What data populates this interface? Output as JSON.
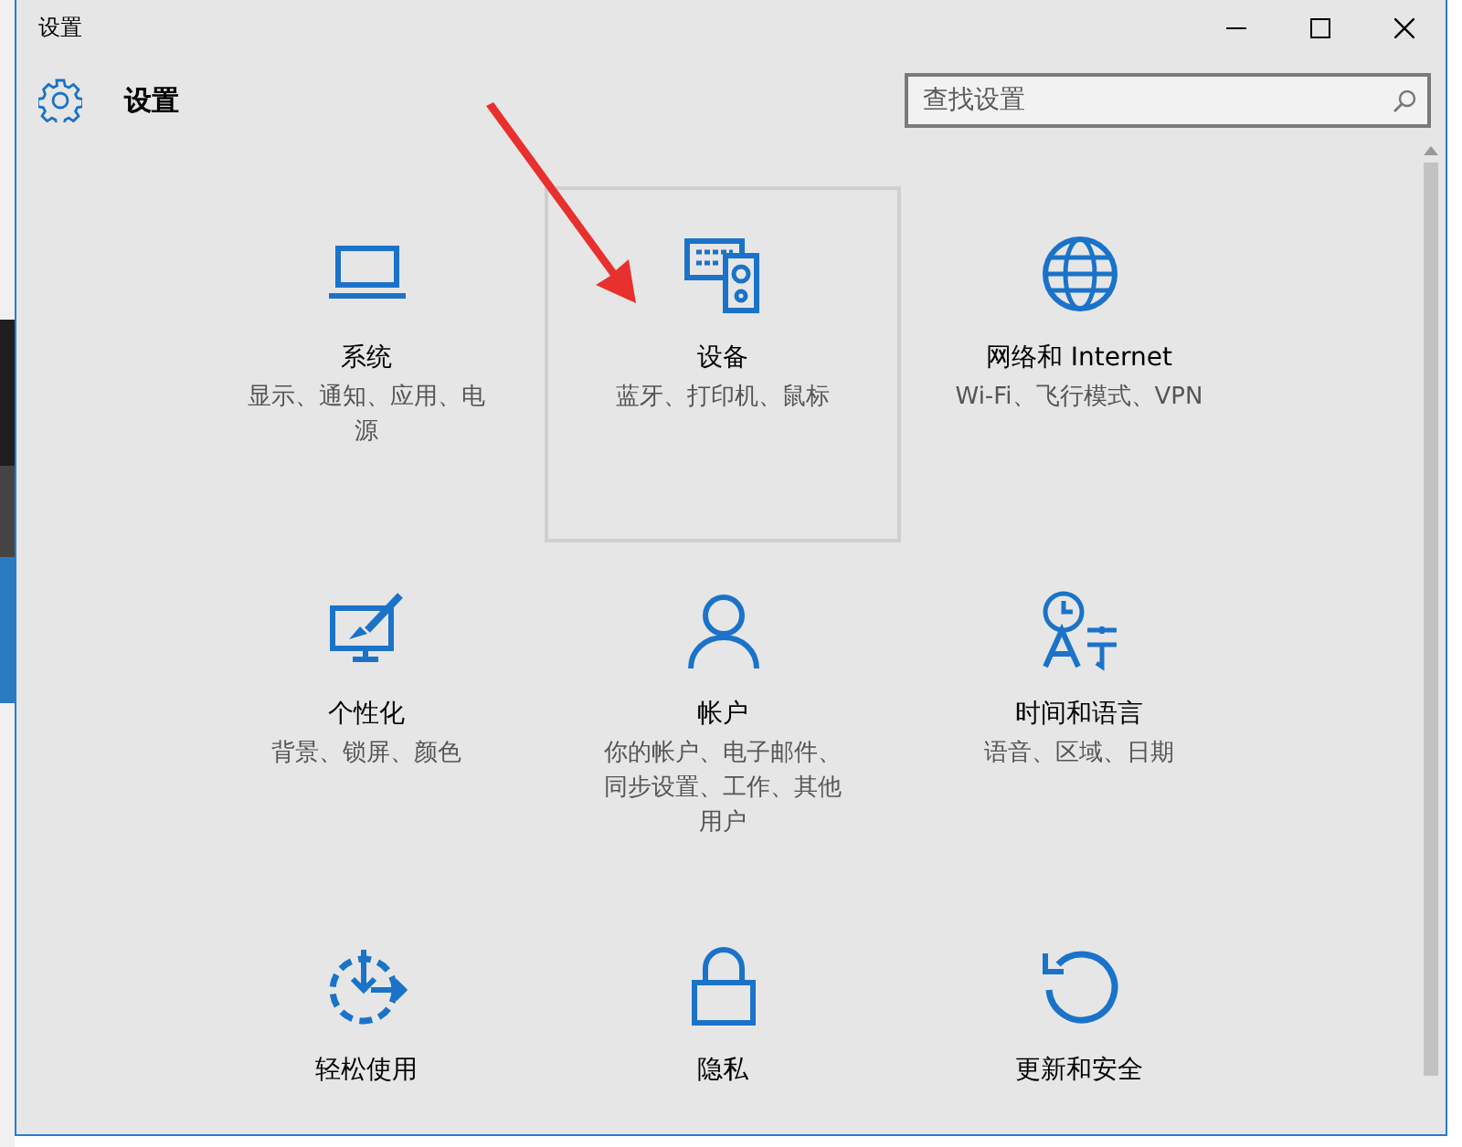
{
  "window": {
    "title": "设置"
  },
  "header": {
    "title": "设置"
  },
  "search": {
    "placeholder": "查找设置"
  },
  "categories": [
    {
      "kind": "laptop",
      "title": "系统",
      "description": "显示、通知、应用、电源",
      "selected": false
    },
    {
      "kind": "devices",
      "title": "设备",
      "description": "蓝牙、打印机、鼠标",
      "selected": true
    },
    {
      "kind": "globe",
      "title": "网络和 Internet",
      "description": "Wi-Fi、飞行模式、VPN",
      "selected": false
    },
    {
      "kind": "paint",
      "title": "个性化",
      "description": "背景、锁屏、颜色",
      "selected": false
    },
    {
      "kind": "person",
      "title": "帐户",
      "description": "你的帐户、电子邮件、同步设置、工作、其他用户",
      "selected": false
    },
    {
      "kind": "language",
      "title": "时间和语言",
      "description": "语音、区域、日期",
      "selected": false
    },
    {
      "kind": "ease",
      "title": "轻松使用",
      "selected": false
    },
    {
      "kind": "lock",
      "title": "隐私",
      "selected": false
    },
    {
      "kind": "update",
      "title": "更新和安全",
      "selected": false
    }
  ]
}
